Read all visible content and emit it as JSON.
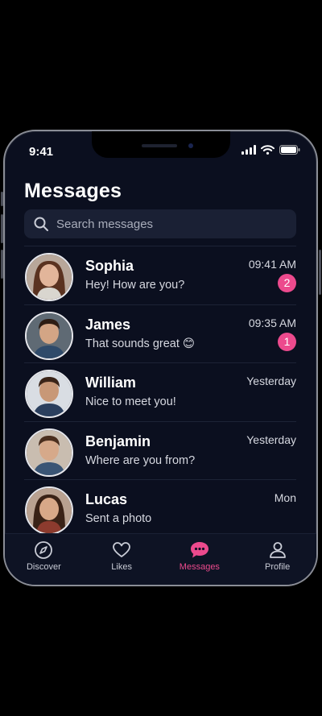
{
  "status_bar": {
    "time": "9:41"
  },
  "header": {
    "title": "Messages"
  },
  "search": {
    "placeholder": "Search messages"
  },
  "conversations": [
    {
      "name": "Sophia",
      "preview": "Hey! How are you?",
      "time": "09:41 AM",
      "unread": "2"
    },
    {
      "name": "James",
      "preview": "That sounds great 😊",
      "time": "09:35 AM",
      "unread": "1"
    },
    {
      "name": "William",
      "preview": "Nice to meet you!",
      "time": "Yesterday",
      "unread": null
    },
    {
      "name": "Benjamin",
      "preview": "Where are you from?",
      "time": "Yesterday",
      "unread": null
    },
    {
      "name": "Lucas",
      "preview": "Sent a photo",
      "time": "Mon",
      "unread": null
    }
  ],
  "tabs": [
    {
      "label": "Discover",
      "icon": "compass-icon",
      "active": false
    },
    {
      "label": "Likes",
      "icon": "heart-icon",
      "active": false
    },
    {
      "label": "Messages",
      "icon": "chat-bubble-icon",
      "active": true
    },
    {
      "label": "Profile",
      "icon": "person-icon",
      "active": false
    }
  ],
  "colors": {
    "accent": "#ec4a8d",
    "background": "#0b0f1f",
    "search_bg": "#1a2034"
  }
}
